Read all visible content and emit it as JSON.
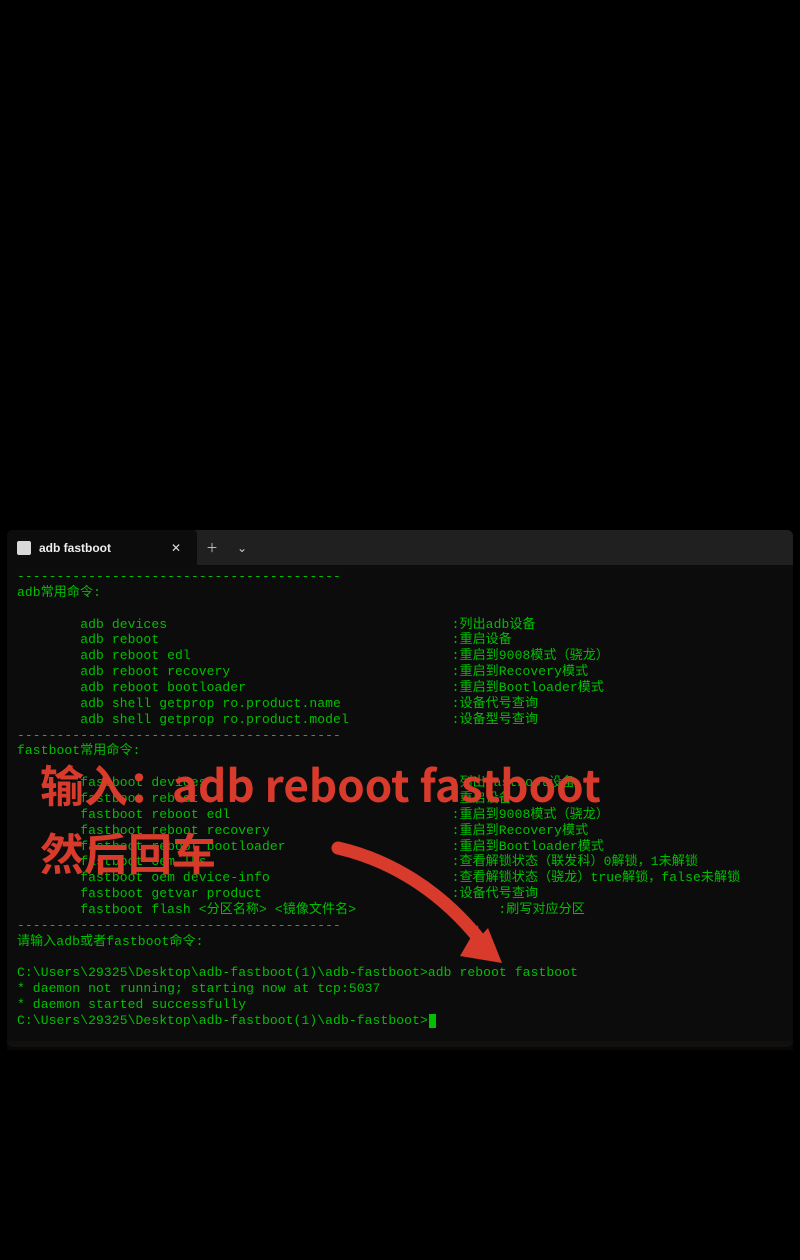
{
  "window": {
    "tab_title": "adb fastboot",
    "close_glyph": "✕",
    "new_tab_glyph": "＋",
    "menu_glyph": "⌄"
  },
  "term": {
    "hr": "-----------------------------------------",
    "adb_header": "adb常用命令:",
    "adb": [
      {
        "cmd": "adb devices",
        "desc": ":列出adb设备"
      },
      {
        "cmd": "adb reboot",
        "desc": ":重启设备"
      },
      {
        "cmd": "adb reboot edl",
        "desc": ":重启到9008模式（骁龙）"
      },
      {
        "cmd": "adb reboot recovery",
        "desc": ":重启到Recovery模式"
      },
      {
        "cmd": "adb reboot bootloader",
        "desc": ":重启到Bootloader模式"
      },
      {
        "cmd": "adb shell getprop ro.product.name",
        "desc": ":设备代号查询"
      },
      {
        "cmd": "adb shell getprop ro.product.model",
        "desc": ":设备型号查询"
      }
    ],
    "fb_header": "fastboot常用命令:",
    "fb": [
      {
        "cmd": "fastboot devices",
        "desc": ":列出fastboot设备"
      },
      {
        "cmd": "fastboot reboot",
        "desc": ":重启设备"
      },
      {
        "cmd": "fastboot reboot edl",
        "desc": ":重启到9008模式（骁龙）"
      },
      {
        "cmd": "fastboot reboot recovery",
        "desc": ":重启到Recovery模式"
      },
      {
        "cmd": "fastboot reboot bootloader",
        "desc": ":重启到Bootloader模式"
      },
      {
        "cmd": "fastboot oem lks",
        "desc": ":查看解锁状态（联发科）0解锁，1未解锁"
      },
      {
        "cmd": "fastboot oem device-info",
        "desc": ":查看解锁状态（骁龙）true解锁，false未解锁"
      },
      {
        "cmd": "fastboot getvar product",
        "desc": ":设备代号查询"
      },
      {
        "cmd": "fastboot flash <分区名称> <镜像文件名>",
        "desc": ":刷写对应分区"
      }
    ],
    "input_prompt": "请输入adb或者fastboot命令:",
    "prompt_path": "C:\\Users\\29325\\Desktop\\adb-fastboot(1)\\adb-fastboot>",
    "user_input": "adb reboot fastboot",
    "daemon1": "* daemon not running; starting now at tcp:5037",
    "daemon2": "* daemon started successfully"
  },
  "overlay": {
    "line1": "输入：adb reboot fastboot",
    "line2": "然后回车"
  },
  "icons": {
    "terminal_tab": "terminal-icon",
    "close_tab": "close-icon",
    "new_tab": "plus-icon",
    "tab_menu": "chevron-down-icon",
    "arrow": "arrow-icon"
  }
}
